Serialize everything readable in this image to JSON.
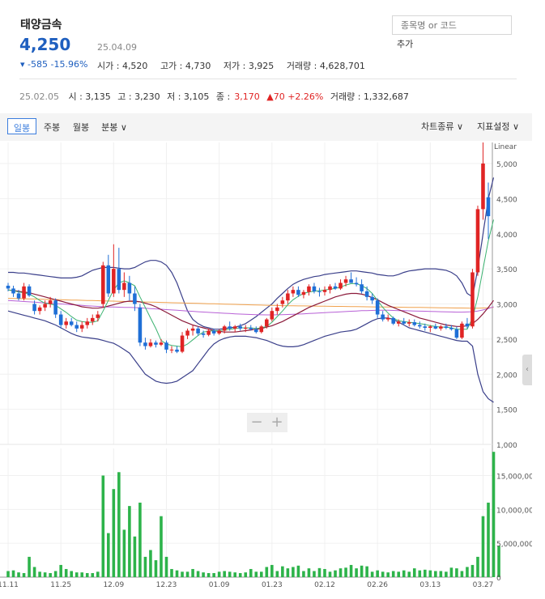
{
  "stock": {
    "name": "태양금속",
    "price": "4,250",
    "date": "25.04.09",
    "change": "▾ -585  -15.96%",
    "open": "시가 : 4,520",
    "high": "고가 : 4,730",
    "low": "저가 : 3,925",
    "volume": "거래량 : 4,628,701"
  },
  "search": {
    "placeholder": "종목명 or 코드",
    "add_label": "추가"
  },
  "prev": {
    "date": "25.02.05",
    "open": "시 : 3,135",
    "high": "고 : 3,230",
    "low": "저 : 3,105",
    "close_label": "종 :",
    "close": "3,170",
    "change": "▲70 +2.26%",
    "volume": "거래량 : 1,332,687"
  },
  "toolbar": {
    "tabs": [
      "일봉",
      "주봉",
      "월봉",
      "분봉 ∨"
    ],
    "chart_type": "차트종류 ∨",
    "indicator": "지표설정 ∨"
  },
  "zoom": {
    "minus": "−",
    "plus": "+"
  },
  "colors": {
    "up": "#e02424",
    "down": "#1f6fd6",
    "volume": "#2db34a",
    "bb": "#3a3f8a",
    "ma5": "#3cb371",
    "ma20": "#8b1a3a",
    "ma60": "#b861d6",
    "ma120": "#f0a04b"
  },
  "chart_data": [
    {
      "type": "candlestick",
      "title": "",
      "ylabel": "",
      "scale_label": "Linear",
      "ylim": [
        1000,
        5300
      ],
      "y_ticks": [
        5000,
        4500,
        4000,
        3500,
        3000,
        2500,
        2000,
        1500,
        1000
      ],
      "y_tick_labels": [
        "5,000",
        "4,500",
        "4,000",
        "3,500",
        "3,000",
        "2,500",
        "2,000",
        "1,500",
        "1,000"
      ],
      "x_tick_labels": [
        "11.11",
        "11.25",
        "12.09",
        "12.23",
        "01.09",
        "01.23",
        "02.12",
        "02.26",
        "03.13",
        "03.27"
      ],
      "x_tick_index": [
        0,
        10,
        20,
        30,
        40,
        50,
        60,
        70,
        80,
        90
      ],
      "candles": [
        [
          3260,
          3300,
          3180,
          3220
        ],
        [
          3220,
          3260,
          3100,
          3150
        ],
        [
          3150,
          3200,
          3050,
          3080
        ],
        [
          3080,
          3300,
          3050,
          3250
        ],
        [
          3250,
          3280,
          3100,
          3120
        ],
        [
          3000,
          3050,
          2850,
          2900
        ],
        [
          2900,
          2980,
          2850,
          2950
        ],
        [
          2950,
          3050,
          2900,
          3000
        ],
        [
          3000,
          3100,
          2950,
          3050
        ],
        [
          3050,
          3080,
          2800,
          2850
        ],
        [
          2850,
          2900,
          2650,
          2700
        ],
        [
          2700,
          2800,
          2650,
          2750
        ],
        [
          2750,
          2800,
          2680,
          2700
        ],
        [
          2700,
          2750,
          2600,
          2650
        ],
        [
          2650,
          2750,
          2600,
          2700
        ],
        [
          2700,
          2800,
          2650,
          2750
        ],
        [
          2750,
          2850,
          2700,
          2800
        ],
        [
          2800,
          2900,
          2750,
          2850
        ],
        [
          3000,
          3600,
          2950,
          3550
        ],
        [
          3550,
          3700,
          3100,
          3150
        ],
        [
          3150,
          3850,
          3100,
          3500
        ],
        [
          3500,
          3800,
          3150,
          3200
        ],
        [
          3200,
          3450,
          3100,
          3300
        ],
        [
          3300,
          3400,
          3050,
          3150
        ],
        [
          3150,
          3250,
          2900,
          3000
        ],
        [
          2950,
          3000,
          2400,
          2450
        ],
        [
          2450,
          2520,
          2350,
          2400
        ],
        [
          2400,
          2500,
          2380,
          2450
        ],
        [
          2450,
          2480,
          2380,
          2420
        ],
        [
          2420,
          2500,
          2400,
          2450
        ],
        [
          2450,
          2480,
          2300,
          2350
        ],
        [
          2350,
          2400,
          2300,
          2350
        ],
        [
          2350,
          2400,
          2300,
          2320
        ],
        [
          2320,
          2600,
          2300,
          2550
        ],
        [
          2550,
          2650,
          2500,
          2620
        ],
        [
          2620,
          2700,
          2550,
          2650
        ],
        [
          2650,
          2680,
          2550,
          2580
        ],
        [
          2580,
          2620,
          2520,
          2560
        ],
        [
          2560,
          2650,
          2540,
          2620
        ],
        [
          2620,
          2650,
          2550,
          2580
        ],
        [
          2580,
          2640,
          2560,
          2620
        ],
        [
          2620,
          2700,
          2580,
          2680
        ],
        [
          2680,
          2750,
          2620,
          2650
        ],
        [
          2650,
          2700,
          2600,
          2680
        ],
        [
          2680,
          2720,
          2620,
          2650
        ],
        [
          2650,
          2700,
          2600,
          2660
        ],
        [
          2660,
          2700,
          2620,
          2640
        ],
        [
          2640,
          2680,
          2580,
          2600
        ],
        [
          2600,
          2700,
          2580,
          2680
        ],
        [
          2680,
          2800,
          2650,
          2780
        ],
        [
          2780,
          2950,
          2750,
          2900
        ],
        [
          2900,
          3000,
          2850,
          2950
        ],
        [
          3000,
          3100,
          2950,
          3050
        ],
        [
          3050,
          3200,
          3000,
          3150
        ],
        [
          3150,
          3250,
          3100,
          3200
        ],
        [
          3200,
          3250,
          3100,
          3130
        ],
        [
          3130,
          3200,
          3080,
          3170
        ],
        [
          3170,
          3280,
          3120,
          3250
        ],
        [
          3250,
          3300,
          3150,
          3180
        ],
        [
          3180,
          3230,
          3105,
          3170
        ],
        [
          3170,
          3250,
          3120,
          3200
        ],
        [
          3200,
          3280,
          3150,
          3250
        ],
        [
          3250,
          3300,
          3200,
          3220
        ],
        [
          3220,
          3350,
          3200,
          3300
        ],
        [
          3300,
          3400,
          3250,
          3350
        ],
        [
          3350,
          3450,
          3300,
          3300
        ],
        [
          3300,
          3380,
          3250,
          3280
        ],
        [
          3280,
          3350,
          3150,
          3180
        ],
        [
          3180,
          3250,
          3050,
          3100
        ],
        [
          3100,
          3150,
          3000,
          3050
        ],
        [
          3050,
          3080,
          2800,
          2850
        ],
        [
          2850,
          2900,
          2750,
          2780
        ],
        [
          2780,
          2850,
          2750,
          2800
        ],
        [
          2800,
          2820,
          2700,
          2720
        ],
        [
          2720,
          2780,
          2680,
          2750
        ],
        [
          2750,
          2800,
          2700,
          2720
        ],
        [
          2720,
          2780,
          2680,
          2740
        ],
        [
          2740,
          2780,
          2680,
          2700
        ],
        [
          2700,
          2750,
          2650,
          2680
        ],
        [
          2680,
          2720,
          2620,
          2660
        ],
        [
          2660,
          2700,
          2600,
          2680
        ],
        [
          2680,
          2720,
          2640,
          2650
        ],
        [
          2650,
          2700,
          2620,
          2680
        ],
        [
          2680,
          2720,
          2640,
          2660
        ],
        [
          2660,
          2700,
          2620,
          2640
        ],
        [
          2640,
          2680,
          2500,
          2520
        ],
        [
          2520,
          2750,
          2500,
          2720
        ],
        [
          2720,
          2800,
          2650,
          2680
        ],
        [
          2680,
          3500,
          2650,
          3450
        ],
        [
          3450,
          4400,
          3400,
          4350
        ],
        [
          4350,
          5300,
          4200,
          5000
        ],
        [
          4520,
          4730,
          3925,
          4250
        ]
      ],
      "ma5": [
        3200,
        3190,
        3170,
        3160,
        3140,
        3100,
        3050,
        3010,
        3000,
        2980,
        2930,
        2880,
        2820,
        2770,
        2750,
        2740,
        2740,
        2760,
        2900,
        3050,
        3200,
        3300,
        3330,
        3300,
        3260,
        3100,
        2950,
        2800,
        2650,
        2480,
        2430,
        2410,
        2400,
        2390,
        2430,
        2490,
        2550,
        2600,
        2610,
        2620,
        2620,
        2630,
        2640,
        2650,
        2660,
        2660,
        2660,
        2650,
        2660,
        2680,
        2740,
        2820,
        2900,
        2990,
        3060,
        3110,
        3150,
        3170,
        3180,
        3190,
        3200,
        3210,
        3220,
        3240,
        3270,
        3290,
        3290,
        3260,
        3220,
        3150,
        3050,
        2950,
        2870,
        2800,
        2760,
        2750,
        2740,
        2730,
        2720,
        2710,
        2690,
        2680,
        2670,
        2670,
        2660,
        2640,
        2640,
        2640,
        2800,
        3100,
        3500,
        3900,
        4200
      ],
      "ma20": [
        3200,
        3190,
        3180,
        3170,
        3160,
        3140,
        3120,
        3100,
        3080,
        3060,
        3040,
        3020,
        3000,
        2980,
        2960,
        2950,
        2940,
        2940,
        2950,
        2970,
        2990,
        3010,
        3030,
        3040,
        3040,
        3030,
        3010,
        2990,
        2960,
        2920,
        2880,
        2840,
        2800,
        2760,
        2730,
        2700,
        2680,
        2660,
        2640,
        2620,
        2610,
        2600,
        2600,
        2600,
        2610,
        2620,
        2630,
        2640,
        2650,
        2670,
        2690,
        2720,
        2750,
        2790,
        2830,
        2870,
        2910,
        2950,
        2980,
        3010,
        3040,
        3070,
        3100,
        3120,
        3140,
        3150,
        3150,
        3140,
        3120,
        3090,
        3060,
        3020,
        2980,
        2950,
        2920,
        2890,
        2860,
        2830,
        2800,
        2780,
        2760,
        2740,
        2720,
        2700,
        2690,
        2680,
        2680,
        2690,
        2720,
        2780,
        2860,
        2950,
        3050
      ],
      "ma60": [
        3050,
        3045,
        3040,
        3035,
        3030,
        3025,
        3020,
        3015,
        3010,
        3005,
        3000,
        2995,
        2990,
        2985,
        2980,
        2975,
        2970,
        2965,
        2960,
        2958,
        2956,
        2954,
        2952,
        2950,
        2948,
        2945,
        2940,
        2935,
        2930,
        2925,
        2920,
        2915,
        2910,
        2905,
        2900,
        2895,
        2890,
        2885,
        2880,
        2876,
        2872,
        2868,
        2864,
        2860,
        2856,
        2852,
        2850,
        2848,
        2846,
        2845,
        2845,
        2846,
        2848,
        2850,
        2853,
        2856,
        2860,
        2864,
        2868,
        2872,
        2876,
        2880,
        2884,
        2888,
        2892,
        2896,
        2900,
        2904,
        2906,
        2908,
        2910,
        2910,
        2910,
        2908,
        2906,
        2904,
        2902,
        2900,
        2898,
        2896,
        2894,
        2892,
        2890,
        2888,
        2886,
        2884,
        2884,
        2886,
        2890,
        2900,
        2915,
        2935,
        2960
      ],
      "ma120": [
        3080,
        3078,
        3076,
        3074,
        3072,
        3070,
        3068,
        3066,
        3064,
        3062,
        3060,
        3058,
        3056,
        3054,
        3052,
        3050,
        3048,
        3046,
        3044,
        3042,
        3040,
        3038,
        3036,
        3034,
        3032,
        3030,
        3028,
        3026,
        3024,
        3022,
        3020,
        3018,
        3016,
        3014,
        3012,
        3010,
        3008,
        3006,
        3004,
        3002,
        3000,
        2998,
        2996,
        2994,
        2992,
        2990,
        2988,
        2986,
        2984,
        2982,
        2980,
        2978,
        2976,
        2975,
        2974,
        2973,
        2972,
        2971,
        2970,
        2969,
        2968,
        2967,
        2966,
        2965,
        2964,
        2963,
        2962,
        2961,
        2960,
        2959,
        2958,
        2957,
        2956,
        2955,
        2954,
        2953,
        2952,
        2951,
        2950,
        2949,
        2948,
        2947,
        2946,
        2945,
        2944,
        2943,
        2942,
        2941,
        2940,
        2940,
        2942,
        2946,
        2952
      ],
      "bb_upper": [
        3450,
        3450,
        3440,
        3440,
        3430,
        3420,
        3410,
        3400,
        3390,
        3380,
        3370,
        3370,
        3370,
        3380,
        3400,
        3440,
        3480,
        3500,
        3520,
        3520,
        3520,
        3510,
        3500,
        3500,
        3520,
        3560,
        3600,
        3620,
        3620,
        3600,
        3550,
        3450,
        3300,
        3100,
        2900,
        2780,
        2720,
        2680,
        2660,
        2640,
        2640,
        2650,
        2660,
        2670,
        2690,
        2720,
        2770,
        2820,
        2880,
        2940,
        3000,
        3080,
        3150,
        3220,
        3280,
        3320,
        3350,
        3370,
        3390,
        3400,
        3420,
        3430,
        3440,
        3450,
        3460,
        3470,
        3470,
        3460,
        3450,
        3440,
        3420,
        3410,
        3400,
        3400,
        3420,
        3450,
        3470,
        3480,
        3490,
        3500,
        3500,
        3500,
        3490,
        3480,
        3450,
        3400,
        3300,
        3150,
        3100,
        3500,
        4000,
        4500,
        4800
      ],
      "bb_lower": [
        2900,
        2880,
        2860,
        2840,
        2820,
        2800,
        2780,
        2760,
        2730,
        2700,
        2660,
        2620,
        2580,
        2550,
        2530,
        2520,
        2510,
        2500,
        2480,
        2460,
        2440,
        2400,
        2350,
        2300,
        2200,
        2100,
        2000,
        1950,
        1900,
        1880,
        1870,
        1880,
        1900,
        1950,
        2000,
        2050,
        2150,
        2250,
        2350,
        2430,
        2480,
        2510,
        2530,
        2540,
        2540,
        2540,
        2530,
        2520,
        2500,
        2480,
        2450,
        2420,
        2400,
        2390,
        2390,
        2400,
        2420,
        2450,
        2480,
        2510,
        2540,
        2560,
        2580,
        2600,
        2610,
        2620,
        2640,
        2680,
        2720,
        2760,
        2790,
        2800,
        2800,
        2780,
        2740,
        2700,
        2660,
        2640,
        2620,
        2600,
        2580,
        2560,
        2540,
        2520,
        2500,
        2480,
        2470,
        2470,
        2400,
        2000,
        1750,
        1650,
        1600
      ],
      "zoom_controls": [
        "−",
        "+"
      ]
    },
    {
      "type": "bar",
      "title": "",
      "ylabel": "",
      "ylim": [
        0,
        19000000
      ],
      "y_ticks": [
        15000000,
        10000000,
        5000000,
        0
      ],
      "y_tick_labels": [
        "15,000,000",
        "10,000,000",
        "5,000,000",
        "0"
      ],
      "values": [
        900000,
        1000000,
        700000,
        600000,
        3000000,
        1500000,
        800000,
        700000,
        600000,
        900000,
        1800000,
        1200000,
        900000,
        700000,
        700000,
        600000,
        600000,
        800000,
        15000000,
        6500000,
        13000000,
        15500000,
        7000000,
        10500000,
        6000000,
        11000000,
        3000000,
        4000000,
        2500000,
        9000000,
        3000000,
        1200000,
        1000000,
        800000,
        800000,
        1200000,
        900000,
        700000,
        600000,
        600000,
        800000,
        900000,
        800000,
        700000,
        600000,
        700000,
        1200000,
        800000,
        800000,
        1500000,
        1800000,
        900000,
        1600000,
        1300000,
        1500000,
        1700000,
        900000,
        1300000,
        900000,
        1332687,
        1200000,
        800000,
        1000000,
        1300000,
        1400000,
        1800000,
        1300000,
        1700000,
        1600000,
        800000,
        1000000,
        800000,
        700000,
        900000,
        800000,
        1000000,
        800000,
        1300000,
        1000000,
        1100000,
        1000000,
        900000,
        900000,
        800000,
        1400000,
        1300000,
        900000,
        1500000,
        1800000,
        3000000,
        9000000,
        11000000,
        18500000,
        4628701
      ]
    }
  ]
}
